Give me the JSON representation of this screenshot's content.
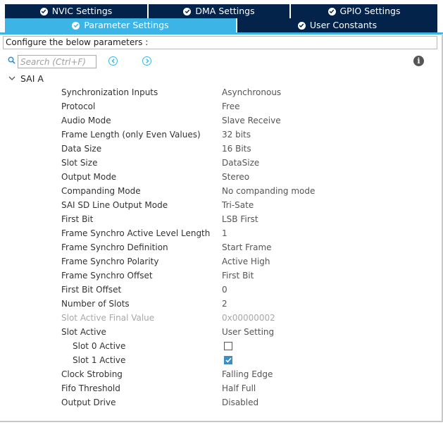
{
  "tabs": [
    {
      "label": "NVIC Settings"
    },
    {
      "label": "DMA Settings"
    },
    {
      "label": "GPIO Settings"
    },
    {
      "label": "Parameter Settings"
    },
    {
      "label": "User Constants"
    }
  ],
  "active_tab": "Parameter Settings",
  "configure_text": "Configure the below parameters :",
  "search": {
    "placeholder": "Search (Ctrl+F)",
    "value": ""
  },
  "group": {
    "label": "SAI A",
    "expanded": true
  },
  "params": [
    {
      "name": "Synchronization Inputs",
      "value": "Asynchronous"
    },
    {
      "name": "Protocol",
      "value": "Free"
    },
    {
      "name": "Audio Mode",
      "value": "Slave Receive"
    },
    {
      "name": "Frame Length (only Even Values)",
      "value": "32 bits"
    },
    {
      "name": "Data Size",
      "value": "16 Bits"
    },
    {
      "name": "Slot Size",
      "value": "DataSize"
    },
    {
      "name": "Output Mode",
      "value": "Stereo"
    },
    {
      "name": "Companding Mode",
      "value": "No companding mode"
    },
    {
      "name": "SAI SD Line Output Mode",
      "value": "Tri-Sate"
    },
    {
      "name": "First Bit",
      "value": "LSB First"
    },
    {
      "name": "Frame Synchro Active Level Length",
      "value": "1"
    },
    {
      "name": "Frame Synchro Definition",
      "value": "Start Frame"
    },
    {
      "name": "Frame Synchro Polarity",
      "value": "Active High"
    },
    {
      "name": "Frame Synchro Offset",
      "value": "First Bit"
    },
    {
      "name": "First Bit Offset",
      "value": "0"
    },
    {
      "name": "Number of Slots",
      "value": "2"
    },
    {
      "name": "Slot Active Final Value",
      "value": "0x00000002"
    },
    {
      "name": "Slot Active",
      "value": "User Setting"
    },
    {
      "name": "Slot 0 Active",
      "checked": false
    },
    {
      "name": "Slot 1 Active",
      "checked": true
    },
    {
      "name": "Clock Strobing",
      "value": "Falling Edge"
    },
    {
      "name": "Fifo Threshold",
      "value": "Half Full"
    },
    {
      "name": "Output Drive",
      "value": "Disabled"
    }
  ],
  "colors": {
    "tab_bg": "#03234b",
    "tab_active_bg": "#3cb4e6",
    "checkbox_checked": "#3c8dc8",
    "disabled_text": "#a8a8a8"
  }
}
